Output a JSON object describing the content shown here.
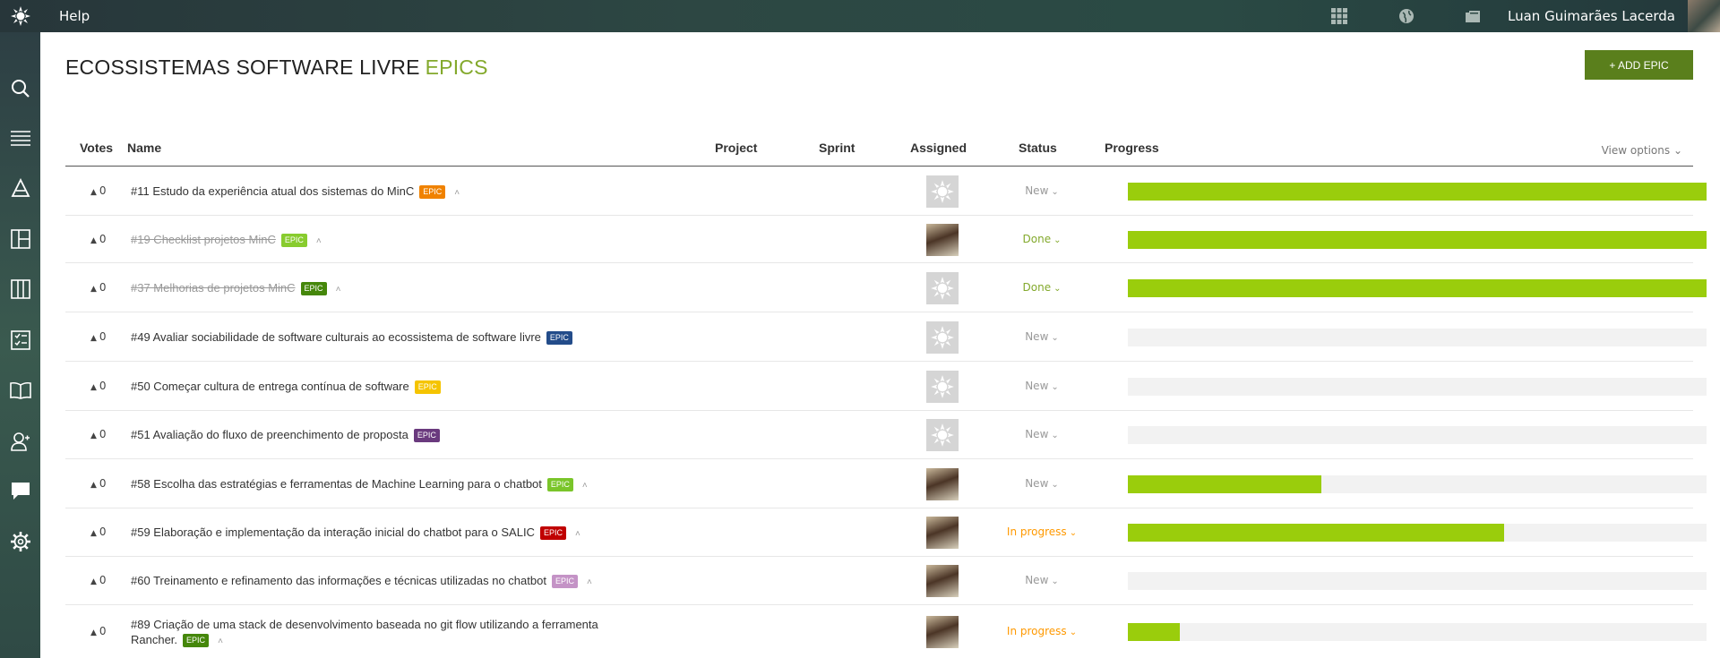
{
  "topbar": {
    "help": "Help",
    "user_name": "Luan Guimarães Lacerda"
  },
  "sidebar": {
    "items": [
      "search-icon",
      "backlog-icon",
      "kanban-icon",
      "taskboard-icon",
      "wiki-icon",
      "issues-icon",
      "team-icon",
      "chat-icon",
      "settings-icon"
    ]
  },
  "page": {
    "title": "ECOSSISTEMAS SOFTWARE LIVRE",
    "subtitle": "EPICS",
    "add_button": "+ ADD EPIC",
    "view_options": "View options"
  },
  "table": {
    "headers": {
      "votes": "Votes",
      "name": "Name",
      "project": "Project",
      "sprint": "Sprint",
      "assigned": "Assigned",
      "status": "Status",
      "progress": "Progress"
    },
    "epic_label": "EPIC",
    "rows": [
      {
        "votes": "0",
        "name": "#11 Estudo da experiência atual dos sistemas do MinC",
        "epic_color": "#f08200",
        "done": false,
        "assigned": "default",
        "status": "New",
        "status_color": "#999999",
        "progress": 1.0,
        "caret": true
      },
      {
        "votes": "0",
        "name": "#19 Checklist projetos MinC",
        "epic_color": "#88cc2e",
        "done": true,
        "assigned": "photo",
        "status": "Done",
        "status_color": "#83a92c",
        "progress": 1.0,
        "caret": true
      },
      {
        "votes": "0",
        "name": "#37 Melhorias de projetos MinC",
        "epic_color": "#45870b",
        "done": true,
        "assigned": "default",
        "status": "Done",
        "status_color": "#83a92c",
        "progress": 1.0,
        "caret": true
      },
      {
        "votes": "0",
        "name": "#49 Avaliar sociabilidade de software culturais ao ecossistema de software livre",
        "epic_color": "#234c8a",
        "done": false,
        "assigned": "default",
        "status": "New",
        "status_color": "#999999",
        "progress": 0.0,
        "caret": false
      },
      {
        "votes": "0",
        "name": "#50 Começar cultura de entrega contínua de software",
        "epic_color": "#f5c400",
        "done": false,
        "assigned": "default",
        "status": "New",
        "status_color": "#999999",
        "progress": 0.0,
        "caret": false
      },
      {
        "votes": "0",
        "name": "#51 Avaliação do fluxo de preenchimento de proposta",
        "epic_color": "#6a3a7e",
        "done": false,
        "assigned": "default",
        "status": "New",
        "status_color": "#999999",
        "progress": 0.0,
        "caret": false
      },
      {
        "votes": "0",
        "name": "#58 Escolha das estratégias e ferramentas de Machine Learning para o chatbot",
        "epic_color": "#7ac52a",
        "done": false,
        "assigned": "photo",
        "status": "New",
        "status_color": "#999999",
        "progress": 0.335,
        "caret": true
      },
      {
        "votes": "0",
        "name": "#59 Elaboração e implementação da interação inicial do chatbot para o SALIC",
        "epic_color": "#c00000",
        "done": false,
        "assigned": "photo",
        "status": "In progress",
        "status_color": "#ff9900",
        "progress": 0.65,
        "caret": true
      },
      {
        "votes": "0",
        "name": "#60 Treinamento e refinamento das informações e técnicas utilizadas no chatbot",
        "epic_color": "#c493c6",
        "done": false,
        "assigned": "photo",
        "status": "New",
        "status_color": "#999999",
        "progress": 0.0,
        "caret": true
      },
      {
        "votes": "0",
        "name": "#89 Criação de uma stack de desenvolvimento baseada no git flow utilizando a ferramenta Rancher.",
        "epic_color": "#45870b",
        "done": false,
        "assigned": "photo",
        "status": "In progress",
        "status_color": "#ff9900",
        "progress": 0.09,
        "caret": true
      }
    ]
  }
}
